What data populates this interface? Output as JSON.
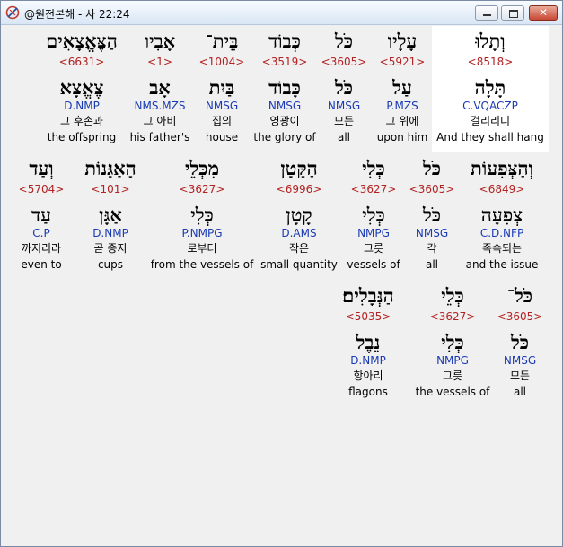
{
  "window": {
    "title": "@원전본해 - 사 22:24"
  },
  "rows": [
    [
      {
        "word": "וְתָלוּ",
        "num": "<8518>",
        "lemma": "תָּלָה",
        "morph": "C.VQACZP",
        "kor": "걸리리니",
        "eng": "And they shall hang"
      },
      {
        "word": "עָלָיו",
        "num": "<5921>",
        "lemma": "עַל",
        "morph": "P.MZS",
        "kor": "그 위에",
        "eng": "upon him"
      },
      {
        "word": "כֹּל",
        "num": "<3605>",
        "lemma": "כֹּל",
        "morph": "NMSG",
        "kor": "모든",
        "eng": "all"
      },
      {
        "word": "כְּבוֹד",
        "num": "<3519>",
        "lemma": "כָּבוֹד",
        "morph": "NMSG",
        "kor": "영광이",
        "eng": "the glory of"
      },
      {
        "word": "בֵּית־",
        "num": "<1004>",
        "lemma": "בַּיִת",
        "morph": "NMSG",
        "kor": "집의",
        "eng": "house"
      },
      {
        "word": "אָבִיו",
        "num": "<1>",
        "lemma": "אָב",
        "morph": "NMS.MZS",
        "kor": "그 아비",
        "eng": "his father's"
      },
      {
        "word": "הַצֶּאֱצָאִים",
        "num": "<6631>",
        "lemma": "צֶאֱצָא",
        "morph": "D.NMP",
        "kor": "그 후손과",
        "eng": "the offspring"
      }
    ],
    [
      {
        "word": "וְהַצְּפִעוֹת",
        "num": "<6849>",
        "lemma": "צְפִעָה",
        "morph": "C.D.NFP",
        "kor": "족속되는",
        "eng": "and the issue"
      },
      {
        "word": "כֹּל",
        "num": "<3605>",
        "lemma": "כֹּל",
        "morph": "NMSG",
        "kor": "각",
        "eng": "all"
      },
      {
        "word": "כְּלִי",
        "num": "<3627>",
        "lemma": "כְּלִי",
        "morph": "NMPG",
        "kor": "그릇",
        "eng": "vessels of"
      },
      {
        "word": "הַקָּטָן",
        "num": "<6996>",
        "lemma": "קָטָן",
        "morph": "D.AMS",
        "kor": "작은",
        "eng": "small quantity"
      },
      {
        "word": "מִכְּלֵי",
        "num": "<3627>",
        "lemma": "כְּלִי",
        "morph": "P.NMPG",
        "kor": "로부터",
        "eng": "from the vessels of"
      },
      {
        "word": "הָאַגָּנוֹת",
        "num": "<101>",
        "lemma": "אַגָּן",
        "morph": "D.NMP",
        "kor": "곧 종지",
        "eng": "cups"
      },
      {
        "word": "וְעַד",
        "num": "<5704>",
        "lemma": "עַד",
        "morph": "C.P",
        "kor": "까지리라",
        "eng": "even to"
      }
    ],
    [
      {
        "word": "כֹּל־",
        "num": "<3605>",
        "lemma": "כֹּל",
        "morph": "NMSG",
        "kor": "모든",
        "eng": "all"
      },
      {
        "word": "כְּלֵי",
        "num": "<3627>",
        "lemma": "כְּלִי",
        "morph": "NMPG",
        "kor": "그릇",
        "eng": "the vessels of"
      },
      {
        "word": "הַנְּבָלִים׃",
        "num": "<5035>",
        "lemma": "נֵבֶל",
        "morph": "D.NMP",
        "kor": "항아리",
        "eng": "flagons"
      }
    ]
  ]
}
